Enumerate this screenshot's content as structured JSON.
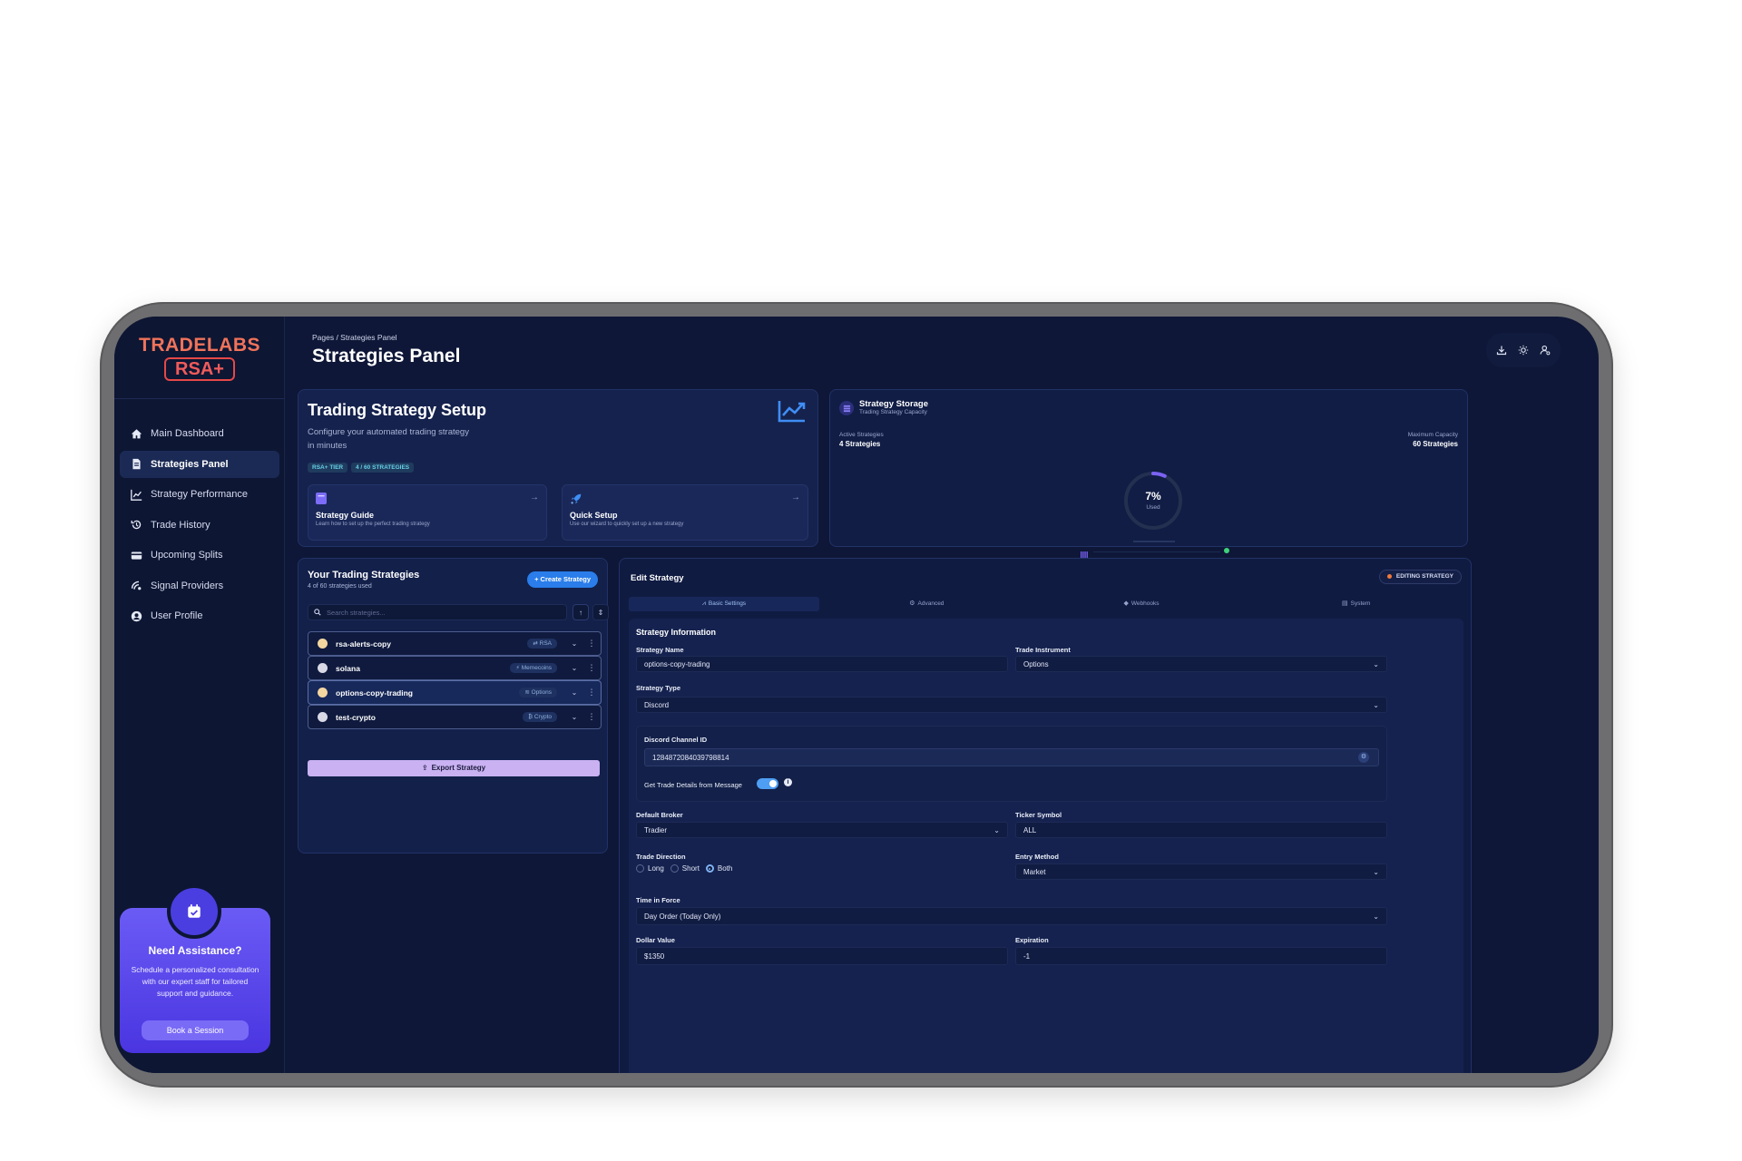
{
  "app": {
    "logo_top": "TRADELABS",
    "logo_bottom": "RSA+"
  },
  "sidebar": {
    "items": [
      {
        "label": "Main Dashboard",
        "icon": "home-icon"
      },
      {
        "label": "Strategies Panel",
        "icon": "strategy-icon",
        "active": true
      },
      {
        "label": "Strategy Performance",
        "icon": "line-chart-icon"
      },
      {
        "label": "Trade History",
        "icon": "history-icon"
      },
      {
        "label": "Upcoming Splits",
        "icon": "card-icon"
      },
      {
        "label": "Signal Providers",
        "icon": "signal-icon"
      },
      {
        "label": "User Profile",
        "icon": "user-circle-icon"
      }
    ],
    "assist": {
      "title": "Need Assistance?",
      "text": "Schedule a personalized consultation with our expert staff for tailored support and guidance.",
      "button": "Book a Session"
    }
  },
  "header": {
    "breadcrumb": "Pages  /  Strategies Panel",
    "title": "Strategies Panel",
    "icons": [
      "download-icon",
      "sun-icon",
      "user-settings-icon"
    ]
  },
  "setup": {
    "title": "Trading Strategy Setup",
    "subtitle": "Configure your automated trading strategy in minutes",
    "tier_pill": "RSA+ TIER",
    "count_pill": "4 / 60 STRATEGIES",
    "guide": {
      "title": "Strategy Guide",
      "text": "Learn how to set up the perfect trading strategy"
    },
    "quick": {
      "title": "Quick Setup",
      "text": "Use our wizard to quickly set up a new strategy"
    }
  },
  "storage": {
    "title": "Strategy Storage",
    "subtitle": "Trading Strategy Capacity",
    "active_label": "Active Strategies",
    "active_value": "4 Strategies",
    "max_label": "Maximum Capacity",
    "max_value": "60 Strategies",
    "percent": "7%",
    "used_label": "Used",
    "used_fraction": 0.07
  },
  "strategies": {
    "title": "Your Trading Strategies",
    "subtitle": "4 of 60 strategies used",
    "create_label": "+ Create Strategy",
    "search_placeholder": "Search strategies...",
    "items": [
      {
        "name": "rsa-alerts-copy",
        "tag": "⇄ RSA",
        "dot": "#f4d6a0"
      },
      {
        "name": "solana",
        "tag": "⚡ Memecoins",
        "dot": "#d9d9e6"
      },
      {
        "name": "options-copy-trading",
        "tag": "≋ Options",
        "dot": "#f4d6a0"
      },
      {
        "name": "test-crypto",
        "tag": "₿ Crypto",
        "dot": "#d9d9e6"
      }
    ],
    "export_label": "Export Strategy"
  },
  "edit": {
    "title": "Edit Strategy",
    "badge": "EDITING STRATEGY",
    "tabs": [
      {
        "label": "Basic Settings",
        "icon": "📈"
      },
      {
        "label": "Advanced",
        "icon": "⚙"
      },
      {
        "label": "Webhooks",
        "icon": "🔔"
      },
      {
        "label": "System",
        "icon": "▤"
      }
    ],
    "section_title": "Strategy Information",
    "strategy_name_label": "Strategy Name",
    "strategy_name_value": "options-copy-trading",
    "trade_instrument_label": "Trade Instrument",
    "trade_instrument_value": "Options",
    "strategy_type_label": "Strategy Type",
    "strategy_type_value": "Discord",
    "discord_channel_label": "Discord Channel ID",
    "discord_channel_value": "1284872084039798814",
    "trade_details_label": "Get Trade Details from Message",
    "default_broker_label": "Default Broker",
    "default_broker_value": "Tradier",
    "ticker_label": "Ticker Symbol",
    "ticker_value": "ALL",
    "trade_direction_label": "Trade Direction",
    "direction_options": [
      "Long",
      "Short",
      "Both"
    ],
    "direction_selected": "Both",
    "entry_method_label": "Entry Method",
    "entry_method_value": "Market",
    "time_in_force_label": "Time in Force",
    "time_in_force_value": "Day Order (Today Only)",
    "dollar_value_label": "Dollar Value",
    "dollar_value": "$1350",
    "expiration_label": "Expiration",
    "expiration_value": "-1"
  }
}
